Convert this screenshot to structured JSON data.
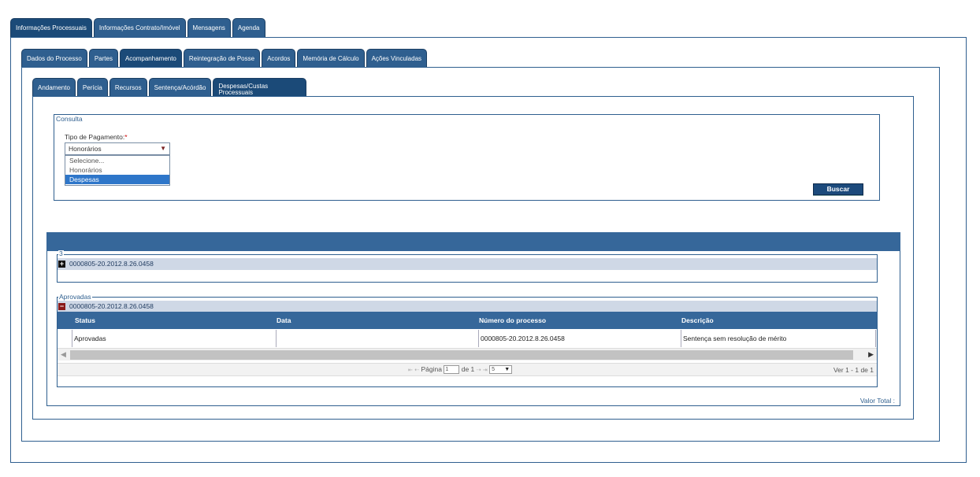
{
  "top_tabs": [
    "Informações Processuais",
    "Informações Contrato/Imóvel",
    "Mensagens",
    "Agenda"
  ],
  "second_tabs": [
    "Dados do Processo",
    "Partes",
    "Acompanhamento",
    "Reintegração de Posse",
    "Acordos",
    "Memória de Cálculo",
    "Ações Vinculadas"
  ],
  "third_tabs": [
    "Andamento",
    "Perícia",
    "Recursos",
    "Sentença/Acórdão",
    "Despesas/Custas Processuais"
  ],
  "consulta": {
    "legend": "Consulta",
    "tipo_label": "Tipo de Pagamento:",
    "required_mark": "*",
    "selected": "Honorários",
    "options": [
      "Selecione...",
      "Honorários",
      "Despesas"
    ],
    "highlighted_option": "Despesas",
    "buscar_label": "Buscar"
  },
  "grid": {
    "group1": {
      "legend": "3",
      "process": "0000805-20.2012.8.26.0458"
    },
    "group2": {
      "legend": "Aprovadas",
      "process": "0000805-20.2012.8.26.0458",
      "columns": [
        "Status",
        "Data",
        "Número do processo",
        "Descrição"
      ],
      "rows": [
        {
          "status": "Aprovadas",
          "data": "",
          "numero": "0000805-20.2012.8.26.0458",
          "descricao": "Sentença sem resolução de mérito"
        }
      ]
    },
    "pager": {
      "page_label": "Página",
      "page_value": "1",
      "of_label": "de 1",
      "rows_per_page": "5",
      "records": "Ver 1 - 1 de 1"
    }
  },
  "valor_total_label": "Valor Total :",
  "colors": {
    "tab": "#2f5f8f",
    "header": "#36679a",
    "selection": "#2e76c9"
  }
}
